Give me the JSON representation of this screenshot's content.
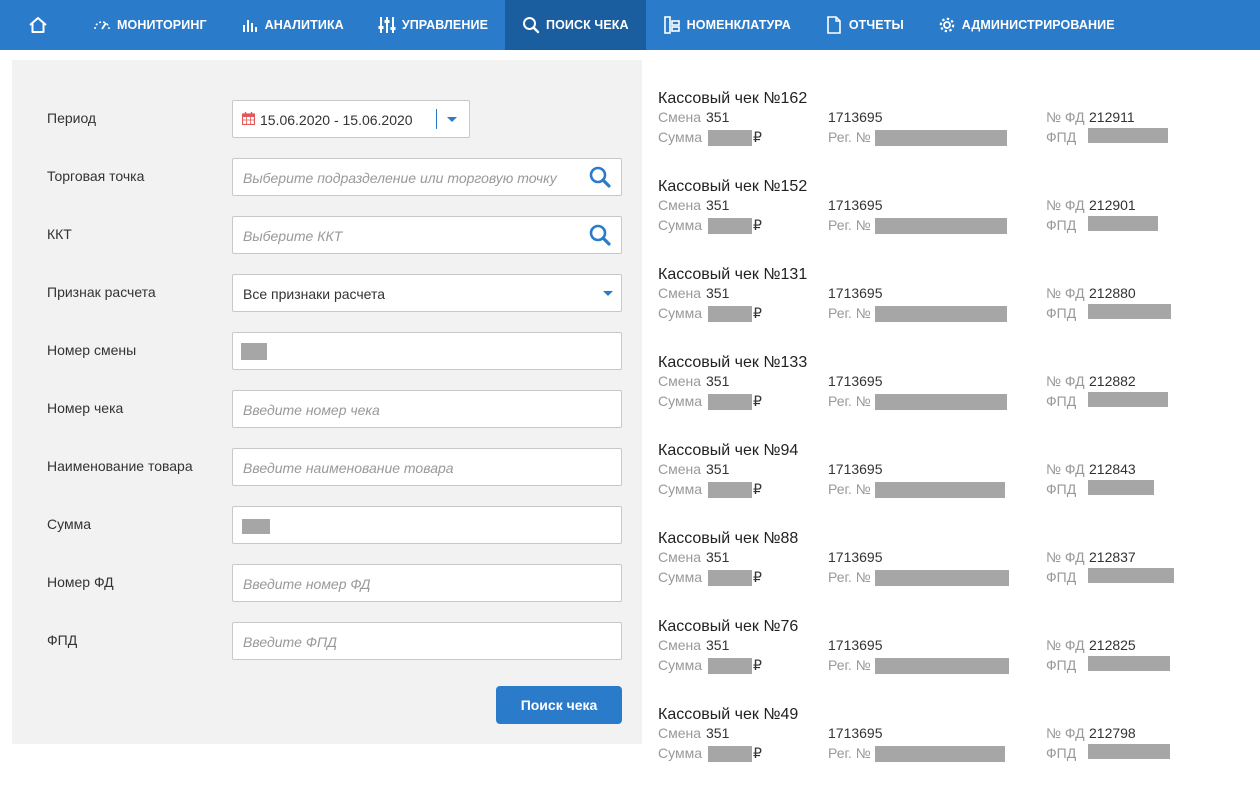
{
  "nav": {
    "items": [
      {
        "label": "МОНИТОРИНГ"
      },
      {
        "label": "АНАЛИТИКА"
      },
      {
        "label": "УПРАВЛЕНИЕ"
      },
      {
        "label": "ПОИСК ЧЕКА"
      },
      {
        "label": "НОМЕНКЛАТУРА"
      },
      {
        "label": "ОТЧЕТЫ"
      },
      {
        "label": "АДМИНИСТРИРОВАНИЕ"
      }
    ],
    "active": "ПОИСК ЧЕКА",
    "accent_color": "#2b7bcb",
    "active_color": "#1b5e9f"
  },
  "form": {
    "period": {
      "label": "Период",
      "value": "15.06.2020 - 15.06.2020"
    },
    "store": {
      "label": "Торговая точка",
      "placeholder": "Выберите подразделение или торговую точку"
    },
    "kkt": {
      "label": "ККТ",
      "placeholder": "Выберите ККТ"
    },
    "payment_sign": {
      "label": "Признак расчета",
      "value": "Все признаки расчета"
    },
    "shift_number": {
      "label": "Номер смены"
    },
    "receipt_number": {
      "label": "Номер чека",
      "placeholder": "Введите номер чека"
    },
    "product_name": {
      "label": "Наименование товара",
      "placeholder": "Введите наименование товара"
    },
    "sum": {
      "label": "Сумма"
    },
    "fd_number": {
      "label": "Номер ФД",
      "placeholder": "Введите номер ФД"
    },
    "fpd": {
      "label": "ФПД",
      "placeholder": "Введите ФПД"
    },
    "submit_label": "Поиск чека"
  },
  "labels": {
    "shift": "Смена",
    "sum": "Сумма",
    "reg": "Рег. №",
    "fd": "№ ФД",
    "fpd": "ФПД",
    "currency": "₽"
  },
  "receipts": [
    {
      "title": "Кассовый чек №162",
      "shift": "351",
      "kkt": "1713695",
      "fd": "212911"
    },
    {
      "title": "Кассовый чек №152",
      "shift": "351",
      "kkt": "1713695",
      "fd": "212901"
    },
    {
      "title": "Кассовый чек №131",
      "shift": "351",
      "kkt": "1713695",
      "fd": "212880"
    },
    {
      "title": "Кассовый чек №133",
      "shift": "351",
      "kkt": "1713695",
      "fd": "212882"
    },
    {
      "title": "Кассовый чек №94",
      "shift": "351",
      "kkt": "1713695",
      "fd": "212843"
    },
    {
      "title": "Кассовый чек №88",
      "shift": "351",
      "kkt": "1713695",
      "fd": "212837"
    },
    {
      "title": "Кассовый чек №76",
      "shift": "351",
      "kkt": "1713695",
      "fd": "212825"
    },
    {
      "title": "Кассовый чек №49",
      "shift": "351",
      "kkt": "1713695",
      "fd": "212798"
    }
  ]
}
